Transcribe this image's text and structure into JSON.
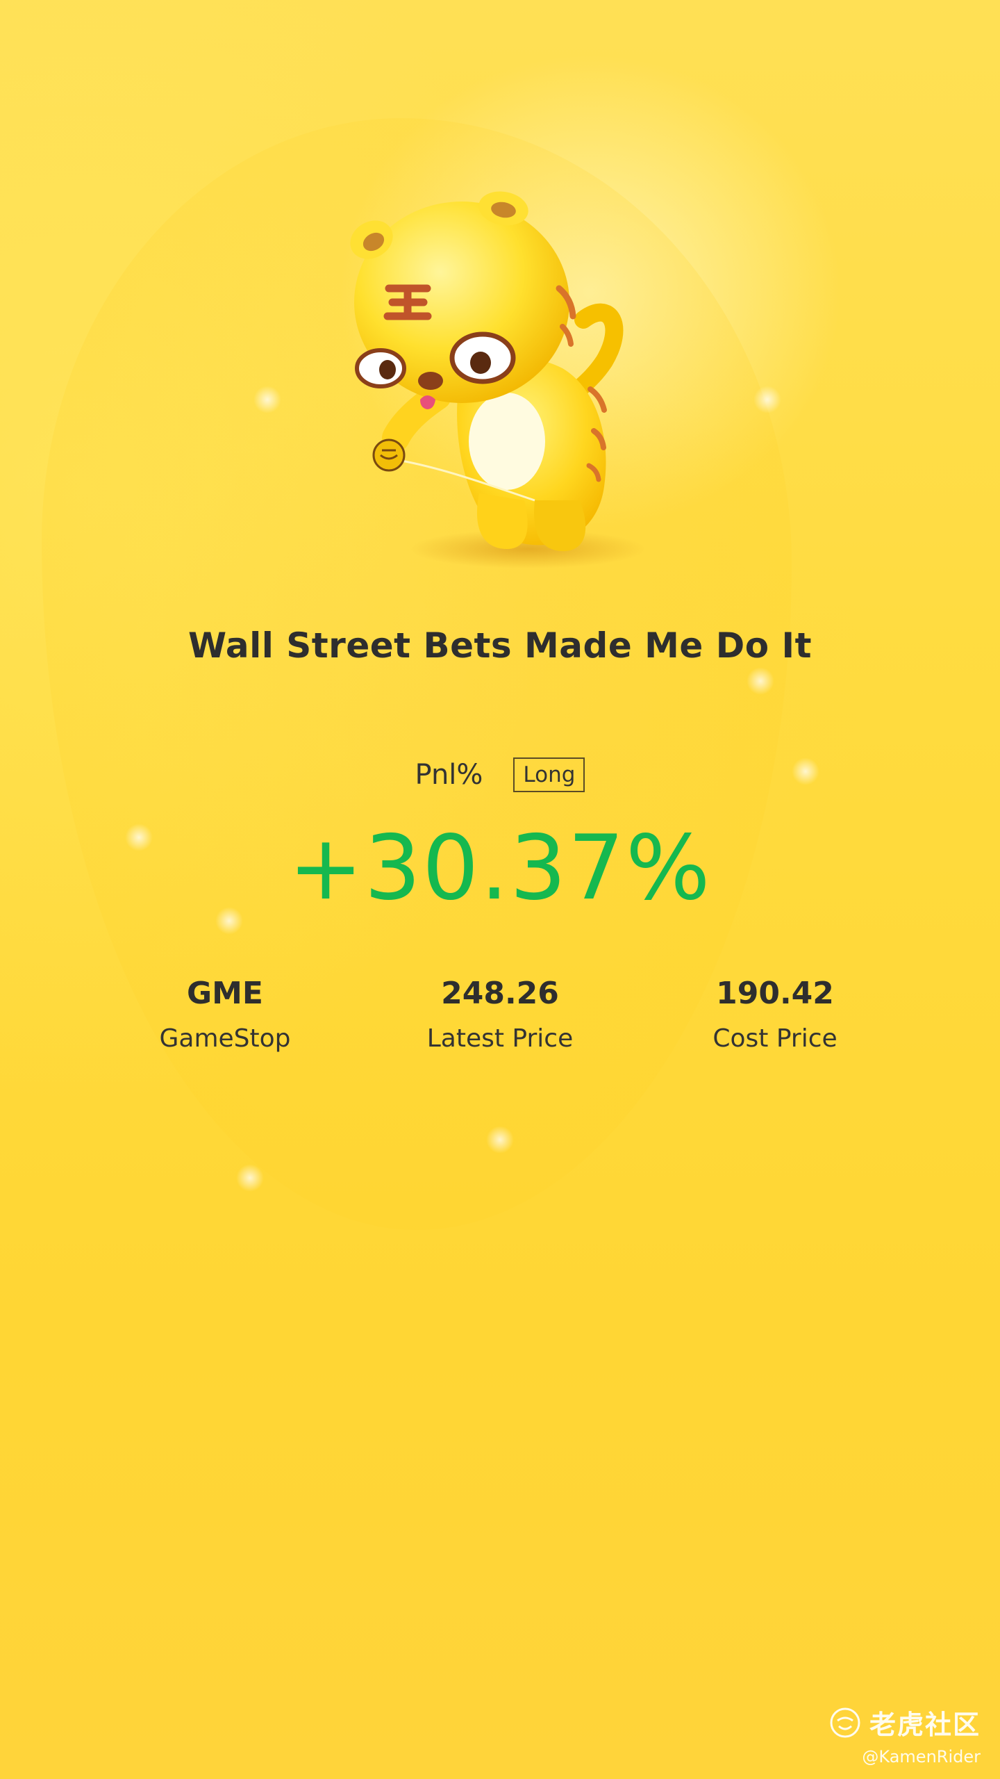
{
  "title": "Wall Street Bets Made Me Do It",
  "pnl": {
    "label": "Pnl%",
    "position_type": "Long",
    "value": "+30.37%",
    "value_color": "#15b84f"
  },
  "stats": [
    {
      "value": "GME",
      "label": "GameStop"
    },
    {
      "value": "248.26",
      "label": "Latest Price"
    },
    {
      "value": "190.42",
      "label": "Cost Price"
    }
  ],
  "watermark": {
    "brand": "老虎社区",
    "user": "@KamenRider",
    "icon": "tiger-logo-icon"
  },
  "mascot": {
    "icon": "tiger-mascot-icon"
  },
  "colors": {
    "background": "#ffd93c",
    "text": "#2e2e2e",
    "gain": "#15b84f"
  }
}
